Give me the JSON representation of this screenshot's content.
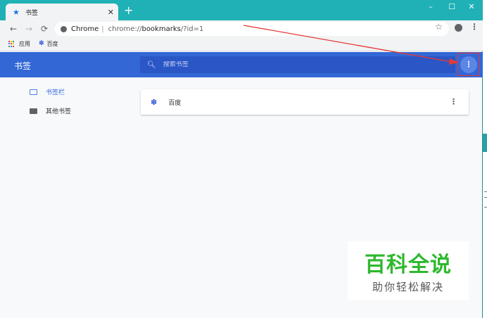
{
  "tab": {
    "title": "书签"
  },
  "window_controls": {
    "minimize": "–",
    "maximize": "☐",
    "close": "✕"
  },
  "toolbar": {
    "site": "Chrome",
    "separator": "|",
    "url_scheme": "chrome://",
    "url_host": "bookmarks",
    "url_path": "/?id=1"
  },
  "bookmark_bar": {
    "items": [
      {
        "label": "应用",
        "icon": "apps-grid-icon"
      },
      {
        "label": "百度",
        "icon": "baidu-paw-icon"
      }
    ]
  },
  "bookmarks": {
    "title": "书签",
    "search_placeholder": "搜索书签"
  },
  "sidebar": {
    "items": [
      {
        "label": "书签栏",
        "active": true
      },
      {
        "label": "其他书签",
        "active": false
      }
    ]
  },
  "list": {
    "rows": [
      {
        "label": "百度",
        "icon": "baidu-paw-icon"
      }
    ]
  },
  "watermark": {
    "line1": "百科全说",
    "line2": "助你轻松解决"
  },
  "colors": {
    "tabstrip": "#1fb1b6",
    "header": "#3367d6",
    "accent": "#1a73e8",
    "annotation": "#e53935",
    "watermark_green": "#2eb82e"
  }
}
